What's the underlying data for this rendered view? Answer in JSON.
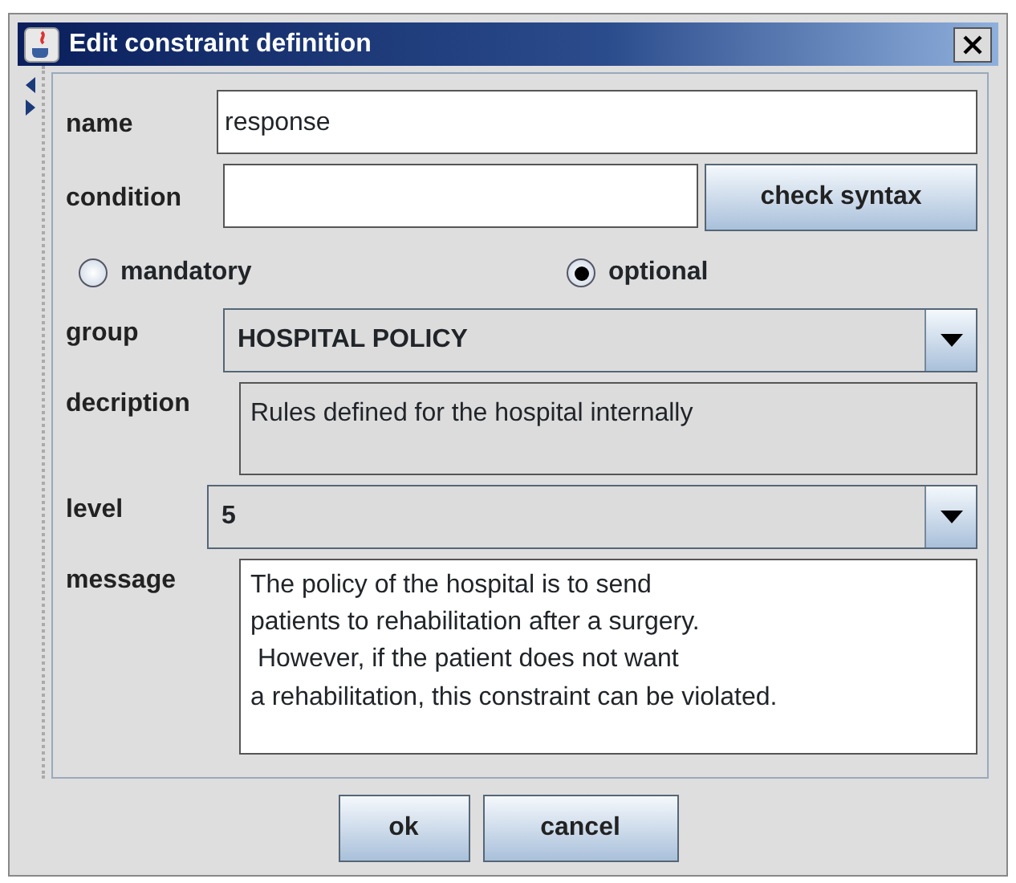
{
  "window": {
    "title": "Edit constraint definition"
  },
  "name": {
    "label": "name",
    "value": "response"
  },
  "condition": {
    "label": "condition",
    "button": "check syntax"
  },
  "radios": [
    {
      "label": "mandatory",
      "selected": false
    },
    {
      "label": "optional",
      "selected": true
    }
  ],
  "group": {
    "label": "group",
    "value": "HOSPITAL POLICY"
  },
  "description": {
    "label": "decription",
    "value": "Rules defined for the hospital internally"
  },
  "level": {
    "label": "level",
    "value": "5"
  },
  "message": {
    "label": "message",
    "value": "The policy of the hospital is to send\npatients to rehabilitation after a surgery.\n However, if the patient does not want\na rehabilitation, this constraint can be violated."
  },
  "buttons": [
    "ok",
    "cancel"
  ]
}
